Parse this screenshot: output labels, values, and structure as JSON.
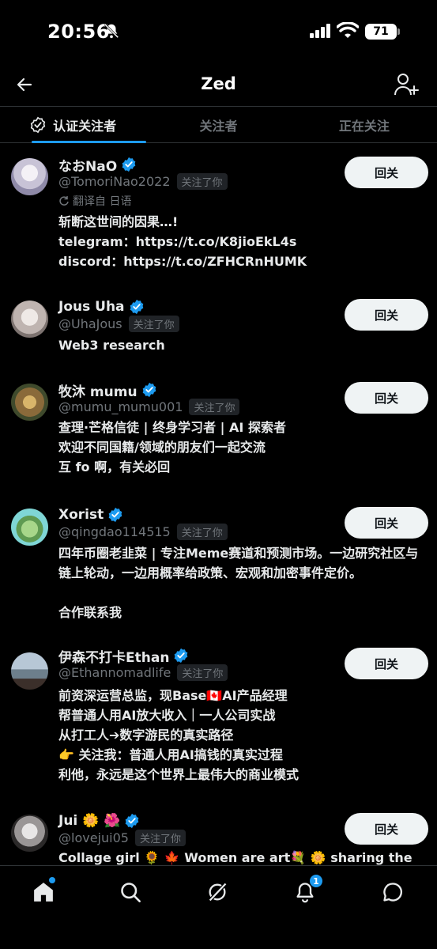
{
  "status_bar": {
    "time": "20:56",
    "battery": "71"
  },
  "header": {
    "title": "Zed"
  },
  "tabs": [
    {
      "label": "认证关注者",
      "active": true
    },
    {
      "label": "关注者",
      "active": false
    },
    {
      "label": "正在关注",
      "active": false
    }
  ],
  "users": [
    {
      "name": "なおNaO",
      "handle": "@TomoriNao2022",
      "follows_you": "关注了你",
      "translated": "翻译自 日语",
      "bio": "斩断这世间的因果…!\ntelegram：https://t.co/K8jioEkL4s\ndiscord：https://t.co/ZFHCRnHUMK",
      "button": "回关"
    },
    {
      "name": "Jous Uha",
      "handle": "@UhaJous",
      "follows_you": "关注了你",
      "bio": "Web3 research",
      "button": "回关"
    },
    {
      "name": "牧沐 mumu",
      "handle": "@mumu_mumu001",
      "follows_you": "关注了你",
      "bio": "查理·芒格信徒 | 终身学习者 | AI 探索者\n欢迎不同国籍/领域的朋友们一起交流\n互 fo 啊，有关必回",
      "button": "回关"
    },
    {
      "name": "Xorist",
      "handle": "@qingdao114515",
      "follows_you": "关注了你",
      "bio": "四年币圈老韭菜 | 专注Meme赛道和预测市场。一边研究社区与链上轮动，一边用概率给政策、宏观和加密事件定价。\n\n合作联系我",
      "button": "回关"
    },
    {
      "name": "伊森不打卡Ethan",
      "handle": "@Ethannomadlife",
      "follows_you": "关注了你",
      "bio": "前资深运营总监，现Base🇨🇦AI产品经理\n帮普通人用AI放大收入｜一人公司实战\n从打工人➔数字游民的真实路径\n👉 关注我：普通人用AI搞钱的真实过程\n利他，永远是这个世界上最伟大的商业模式",
      "button": "回关"
    },
    {
      "name": "Jui 🌼 🌺",
      "handle": "@lovejui05",
      "follows_you": "关注了你",
      "bio": "Collage girl 🌻 🍁 Women are art💐 🌼 sharing the",
      "button": "回关"
    }
  ],
  "nav": {
    "notifications_badge": "1",
    "icons": [
      "home-icon",
      "search-icon",
      "grok-icon",
      "bell-icon",
      "chat-icon"
    ]
  },
  "colors": {
    "accent": "#1d9bf0",
    "background": "#000000",
    "button_bg": "#eff3f4"
  }
}
